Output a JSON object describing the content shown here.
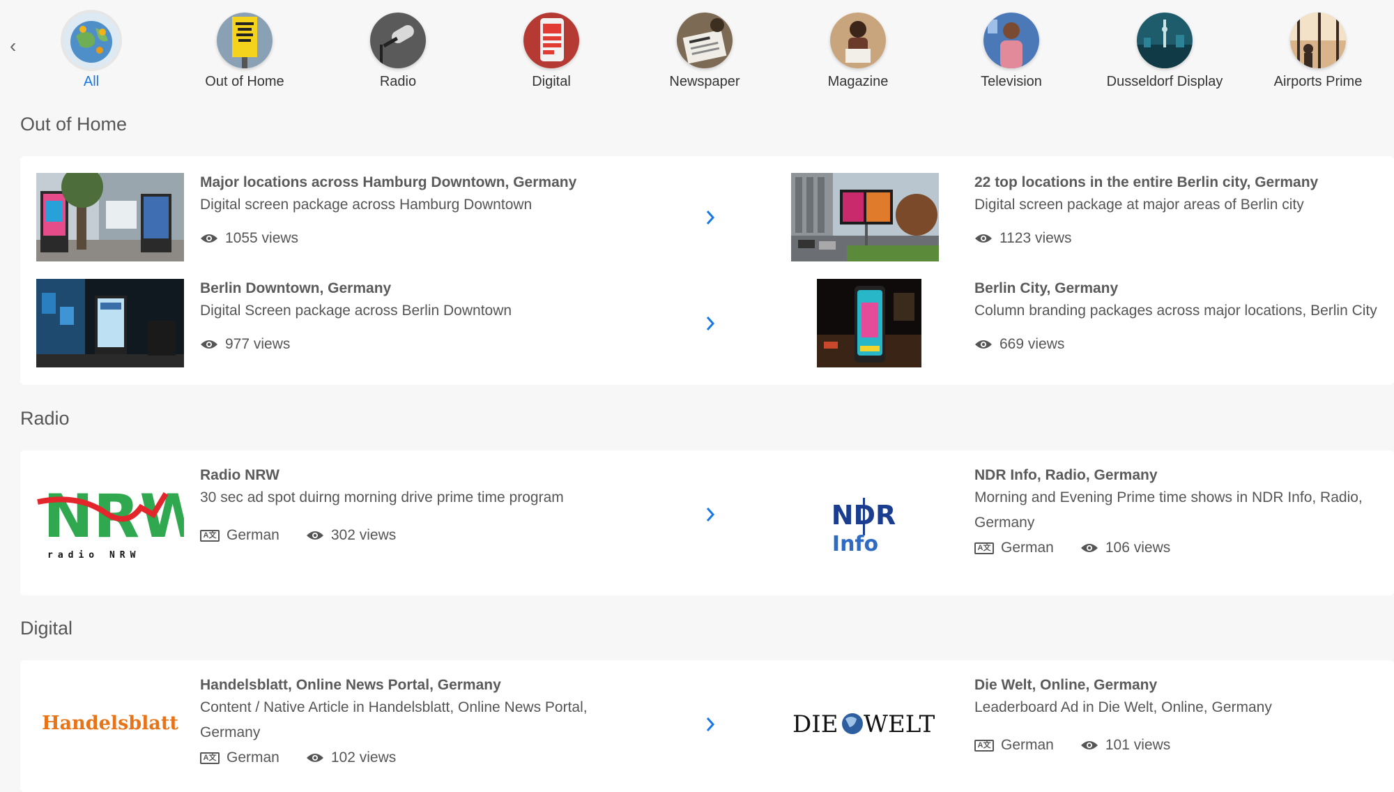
{
  "nav": {
    "prev_glyph": "‹"
  },
  "categories": [
    {
      "label": "All",
      "active": true
    },
    {
      "label": "Out of Home"
    },
    {
      "label": "Radio"
    },
    {
      "label": "Digital"
    },
    {
      "label": "Newspaper"
    },
    {
      "label": "Magazine"
    },
    {
      "label": "Television"
    },
    {
      "label": "Dusseldorf Display"
    },
    {
      "label": "Airports Prime"
    }
  ],
  "sections": {
    "ooh": {
      "title": "Out of Home",
      "items": [
        {
          "title": "Major locations across Hamburg Downtown, Germany",
          "desc": "Digital screen package across Hamburg Downtown",
          "views": "1055 views"
        },
        {
          "title": "22 top locations in the entire Berlin city, Germany",
          "desc": "Digital screen package at major areas of Berlin city",
          "views": "1123 views"
        },
        {
          "title": "Berlin Downtown, Germany",
          "desc": "Digital Screen package across Berlin Downtown",
          "views": "977 views"
        },
        {
          "title": "Berlin City, Germany",
          "desc": "Column branding packages across major locations, Berlin City",
          "views": "669 views"
        }
      ]
    },
    "radio": {
      "title": "Radio",
      "items": [
        {
          "title": "Radio NRW",
          "desc": "30 sec ad spot duirng morning drive prime time program",
          "lang": "German",
          "views": "302 views",
          "logo_big": "NRW",
          "logo_small": "radio NRW"
        },
        {
          "title": "NDR Info, Radio, Germany",
          "desc": "Morning and Evening Prime time shows in NDR Info, Radio, Germany",
          "lang": "German",
          "views": "106 views",
          "logo_top": "NDR",
          "logo_bottom": "Info"
        }
      ]
    },
    "digital": {
      "title": "Digital",
      "items": [
        {
          "title": "Handelsblatt, Online News Portal, Germany",
          "desc": "Content / Native Article in Handelsblatt, Online News Portal, Germany",
          "lang": "German",
          "views": "102 views",
          "logo": "Handelsblatt"
        },
        {
          "title": "Die Welt, Online, Germany",
          "desc": "Leaderboard Ad in Die Welt, Online, Germany",
          "lang": "German",
          "views": "101 views",
          "logo_left": "DIE",
          "logo_right": "WELT"
        }
      ]
    }
  },
  "icons": {
    "eye": "eye-icon",
    "language": "language-icon",
    "chevron": "chevron-right-icon"
  },
  "colors": {
    "accent": "#1677e8",
    "background": "#f7f7f7",
    "card": "#ffffff",
    "nrw_green": "#2fa84f",
    "nrw_red": "#e3262b",
    "ndr_blue": "#1a3d8f",
    "handelsblatt_orange": "#e8741a"
  }
}
